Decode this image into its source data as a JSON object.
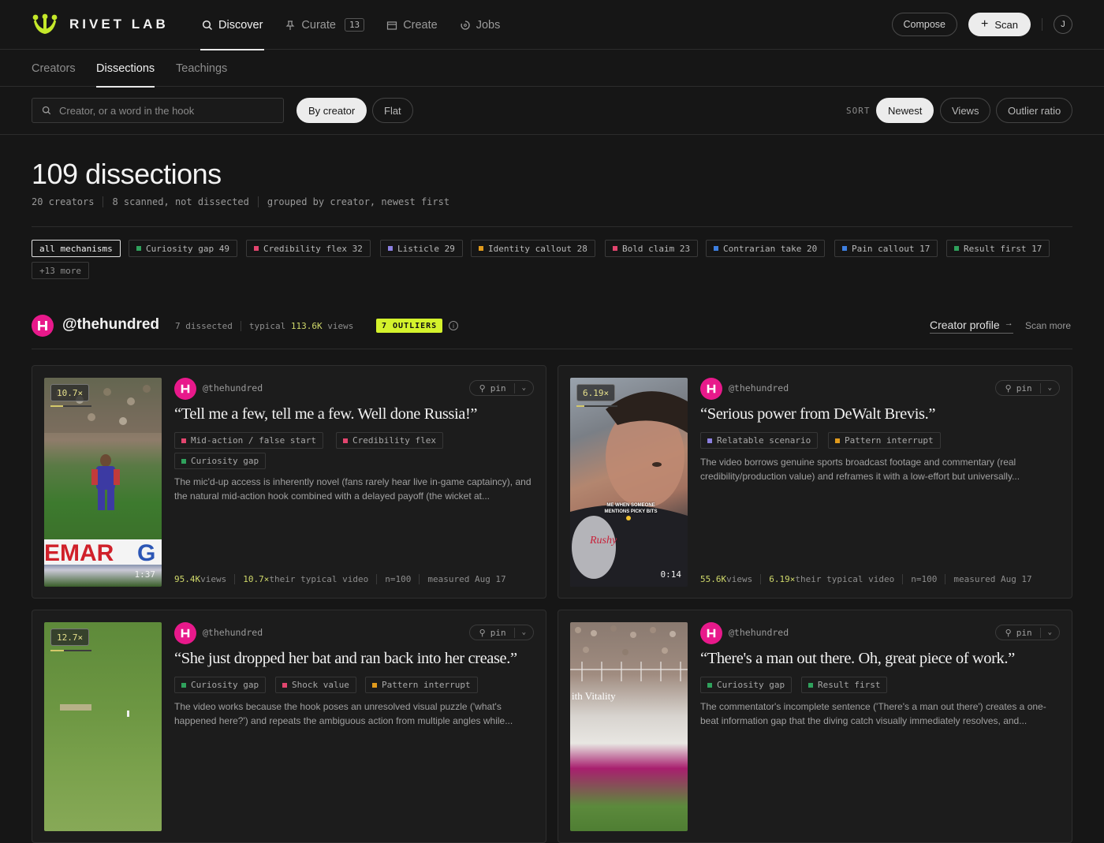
{
  "brand": {
    "name": "RIVET LAB"
  },
  "nav": [
    {
      "label": "Discover",
      "icon": "search-icon"
    },
    {
      "label": "Curate",
      "icon": "pin-icon",
      "count": "13"
    },
    {
      "label": "Create",
      "icon": "calendar-icon"
    },
    {
      "label": "Jobs",
      "icon": "spinner-icon"
    }
  ],
  "topbar": {
    "compose_label": "Compose",
    "scan_label": "Scan",
    "user_initial": "J"
  },
  "subtabs": [
    "Creators",
    "Dissections",
    "Teachings"
  ],
  "filters": {
    "search_placeholder": "Creator, or a word in the hook",
    "group_by_creator": "By creator",
    "flat": "Flat",
    "sort_label": "SORT",
    "sort_newest": "Newest",
    "sort_views": "Views",
    "sort_outlier": "Outlier ratio"
  },
  "summary": {
    "title": "109 dissections",
    "meta": [
      "20 creators",
      "8 scanned, not dissected",
      "grouped by creator, newest first"
    ]
  },
  "mechanisms": [
    {
      "label": "all mechanisms",
      "color": ""
    },
    {
      "label": "Curiosity gap 49",
      "color": "#2fa15c"
    },
    {
      "label": "Credibility flex 32",
      "color": "#e2456e"
    },
    {
      "label": "Listicle 29",
      "color": "#8b7fe0"
    },
    {
      "label": "Identity callout 28",
      "color": "#e09a1c"
    },
    {
      "label": "Bold claim 23",
      "color": "#e2456e"
    },
    {
      "label": "Contrarian take 20",
      "color": "#3e7fe0"
    },
    {
      "label": "Pain callout 17",
      "color": "#3e7fe0"
    },
    {
      "label": "Result first 17",
      "color": "#2fa15c"
    },
    {
      "label": "+13 more",
      "color": ""
    }
  ],
  "creator": {
    "handle": "@thehundred",
    "dissected": "7 dissected",
    "typical_prefix": "typical",
    "typical_views": "113.6K",
    "typical_suffix": "views",
    "outliers": "7 OUTLIERS",
    "profile_link": "Creator profile",
    "scan_more": "Scan more",
    "brand_color": "#e8198b"
  },
  "cards": [
    {
      "handle": "@thehundred",
      "multiplier": "10.7×",
      "multiplier_fraction": 0.3,
      "duration": "1:37",
      "hook": "“Tell me a few, tell me a few. Well done Russia!”",
      "tags": [
        {
          "label": "Mid-action / false start",
          "color": "#e2456e"
        },
        {
          "label": "Credibility flex",
          "color": "#e2456e"
        },
        {
          "label": "Curiosity gap",
          "color": "#2fa15c"
        }
      ],
      "description": "The mic'd-up access is inherently novel (fans rarely hear live in-game captaincy), and the natural mid-action hook combined with a delayed payoff (the wicket at...",
      "views": "95.4K",
      "views_label": "views",
      "ratio": "10.7×",
      "ratio_label": "their typical video",
      "n": "n=100",
      "measured": "measured Aug 17",
      "pin": "pin"
    },
    {
      "handle": "@thehundred",
      "multiplier": "6.19×",
      "multiplier_fraction": 0.2,
      "duration": "0:14",
      "caption": "ME WHEN SOMEONE MENTIONS PICKY BITS",
      "hook": "“Serious power from DeWalt Brevis.”",
      "tags": [
        {
          "label": "Relatable scenario",
          "color": "#8b7fe0"
        },
        {
          "label": "Pattern interrupt",
          "color": "#e09a1c"
        }
      ],
      "description": "The video borrows genuine sports broadcast footage and commentary (real credibility/production value) and reframes it with a low-effort but universally...",
      "views": "55.6K",
      "views_label": "views",
      "ratio": "6.19×",
      "ratio_label": "their typical video",
      "n": "n=100",
      "measured": "measured Aug 17",
      "pin": "pin"
    },
    {
      "handle": "@thehundred",
      "multiplier": "12.7×",
      "multiplier_fraction": 0.33,
      "hook": "“She just dropped her bat and ran back into her crease.”",
      "tags": [
        {
          "label": "Curiosity gap",
          "color": "#2fa15c"
        },
        {
          "label": "Shock value",
          "color": "#e2456e"
        },
        {
          "label": "Pattern interrupt",
          "color": "#e09a1c"
        }
      ],
      "description": "The video works because the hook poses an unresolved visual puzzle ('what's happened here?') and repeats the ambiguous action from multiple angles while...",
      "pin": "pin"
    },
    {
      "handle": "@thehundred",
      "hook": "“There's a man out there. Oh, great piece of work.”",
      "board_text": "ith Vitality",
      "tags": [
        {
          "label": "Curiosity gap",
          "color": "#2fa15c"
        },
        {
          "label": "Result first",
          "color": "#2fa15c"
        }
      ],
      "description": "The commentator's incomplete sentence ('There's a man out there') creates a one-beat information gap that the diving catch visually immediately resolves, and...",
      "pin": "pin"
    }
  ]
}
